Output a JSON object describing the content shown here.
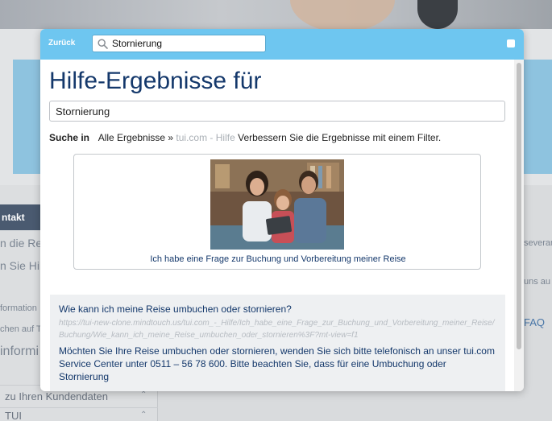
{
  "background": {
    "sidebar": {
      "contact_label": "ntakt",
      "items": [
        "n die Rei",
        "n Sie Hil"
      ],
      "small_items": [
        "formation",
        "chen auf T"
      ],
      "info_item": "informi",
      "customer_data_item": "zu Ihren Kundendaten",
      "tui_item": "TUI"
    },
    "right_fragments": [
      "severan",
      "uns au"
    ],
    "right_link": "FAQ"
  },
  "modal": {
    "header": {
      "back_label": "Zurück",
      "search_value": "Stornierung",
      "search_icon": "search-icon"
    },
    "title": "Hilfe-Ergebnisse für",
    "query_value": "Stornierung",
    "filter": {
      "label": "Suche in",
      "all_results": "Alle Ergebnisse »",
      "scope": "tui.com - Hilfe",
      "improve_text": "Verbessern Sie die Ergebnisse mit einem Filter."
    },
    "category_card": {
      "caption": "Ich habe eine Frage zur Buchung und Vorbereitung meiner Reise"
    },
    "results": [
      {
        "title": "Wie kann ich meine Reise umbuchen oder stornieren?",
        "url": "https://tui-new-clone.mindtouch.us/tui.com_-_Hilfe/Ich_habe_eine_Frage_zur_Buchung_und_Vorbereitung_meiner_Reise/Buchung/Wie_kann_ich_meine_Reise_umbuchen_oder_stornieren%3F?mt-view=f1",
        "snippet": "Möchten Sie Ihre Reise umbuchen oder stornieren, wenden Sie sich bitte telefonisch an unser tui.com Service Center unter 0511 – 56 78 600. Bitte beachten Sie, dass für eine Umbuchung oder Stornierung"
      }
    ]
  },
  "colors": {
    "header_bg": "#6ec6f0",
    "title_text": "#14386b",
    "result_bg": "#eef0f2"
  }
}
